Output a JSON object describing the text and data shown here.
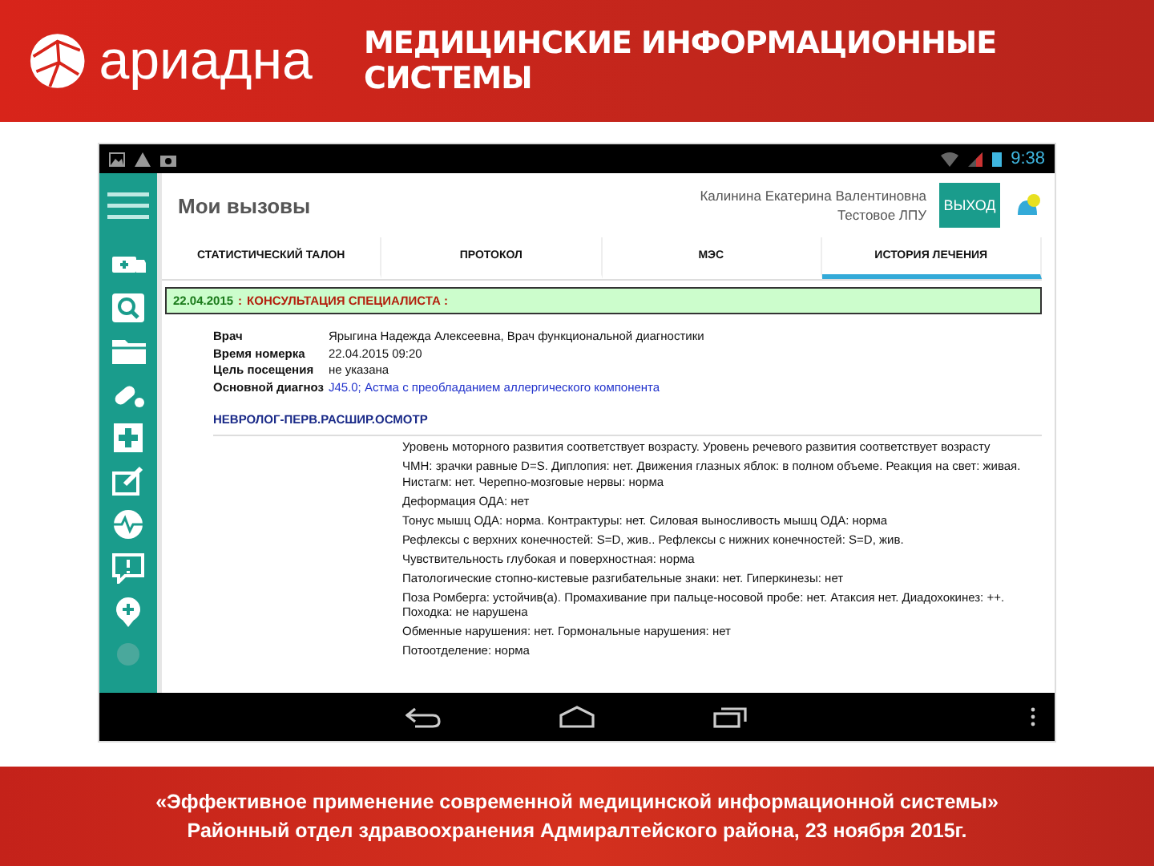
{
  "slide_header": {
    "logo_text": "ариадна",
    "title": "МЕДИЦИНСКИЕ ИНФОРМАЦИОННЫЕ СИСТЕМЫ"
  },
  "app": {
    "status_bar": {
      "time": "9:38"
    },
    "page_title": "Мои вызовы",
    "user": {
      "name": "Калинина Екатерина Валентиновна",
      "organization": "Тестовое ЛПУ"
    },
    "logout_button": "ВЫХОД",
    "tabs": [
      {
        "label": "СТАТИСТИЧЕСКИЙ ТАЛОН",
        "selected": false
      },
      {
        "label": "ПРОТОКОЛ",
        "selected": false
      },
      {
        "label": "МЭС",
        "selected": false
      },
      {
        "label": "ИСТОРИЯ ЛЕЧЕНИЯ",
        "selected": true
      }
    ],
    "record": {
      "date": "22.04.2015",
      "separator": ":",
      "title": "КОНСУЛЬТАЦИЯ СПЕЦИАЛИСТА :"
    },
    "fields": [
      {
        "label": "Врач",
        "value": "Ярыгина Надежда Алексеевна, Врач функциональной диагностики",
        "kind": "text"
      },
      {
        "label": "Время номерка",
        "value": "22.04.2015 09:20",
        "kind": "text"
      },
      {
        "label": "Цель посещения",
        "value": "не указана",
        "kind": "text"
      },
      {
        "label": "Основной диагноз",
        "value": "J45.0; Астма с преобладанием аллергического компонента",
        "kind": "link"
      }
    ],
    "section_title": "НЕВРОЛОГ-ПЕРВ.РАСШИР.ОСМОТР",
    "notes": [
      "Уровень моторного развития соответствует возрасту. Уровень речевого развития соответствует возрасту",
      "ЧМН: зрачки равные D=S. Диплопия: нет. Движения глазных яблок: в полном объеме. Реакция на свет: живая. Нистагм: нет. Черепно-мозговые нервы: норма",
      "Деформация ОДА: нет",
      "Тонус мышц ОДА: норма. Контрактуры: нет. Силовая выносливость мышц ОДА: норма",
      "Рефлексы с верхних конечностей: S=D, жив.. Рефлексы с нижних конечностей: S=D, жив.",
      "Чувствительность глубокая и поверхностная: норма",
      "Патологические стопно-кистевые разгибательные знаки: нет. Гиперкинезы: нет",
      "Поза Ромберга: устойчив(а). Промахивание при пальце-носовой пробе: нет. Атаксия нет. Диадохокинез: ++. Походка: не нарушена",
      "Обменные нарушения: нет. Гормональные нарушения: нет",
      "Потоотделение: норма"
    ]
  },
  "slide_footer": {
    "lines": [
      "«Эффективное применение современной медицинской информационной системы»",
      "Районный отдел здравоохранения Адмиралтейского района, 23 ноября 2015г."
    ]
  }
}
